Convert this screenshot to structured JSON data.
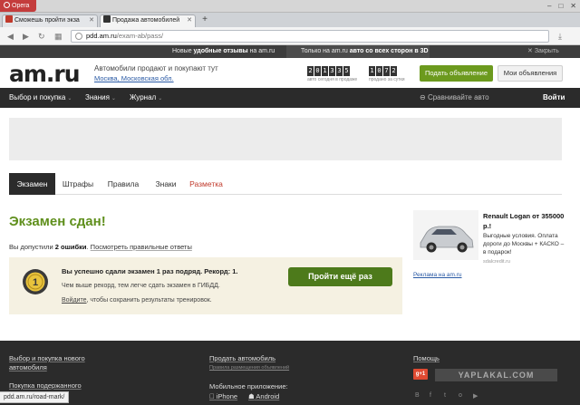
{
  "browser": {
    "menu_label": "Opera",
    "tabs": [
      {
        "title": "Сможешь пройти экза"
      },
      {
        "title": "Продажа автомобилей"
      }
    ],
    "url_host": "pdd.am.ru",
    "url_path": "/exam-ab/pass/",
    "status_url": "pdd.am.ru/road-mark/"
  },
  "promo": {
    "text1_pre": "Новые ",
    "text1_bold": "удобные отзывы",
    "text1_post": " на am.ru",
    "text2_pre": "Только на am.ru ",
    "text2_bold": "авто со всех сторон в 3D",
    "close_label": "Закрыть"
  },
  "header": {
    "logo": "am.ru",
    "tagline": "Автомобили продают и покупают тут",
    "region": "Москва, Московская обл.",
    "counter_total": "201335",
    "counter_total_label": "авто сегодня в продаже",
    "counter_day": "1072",
    "counter_day_label": "продано за сутки",
    "sell_button": "Подать объявление",
    "my_ads_button": "Мои объявления"
  },
  "menu": {
    "items": [
      "Выбор и покупка",
      "Знания",
      "Журнал"
    ],
    "compare": "Сравнивайте авто",
    "login": "Войти"
  },
  "section_tabs": [
    "Экзамен",
    "Штрафы",
    "Правила",
    "Знаки",
    "Разметка"
  ],
  "result": {
    "title": "Экзамен сдан!",
    "errors_pre": "Вы допустили ",
    "errors_count": "2 ошибки",
    "errors_post": ".",
    "show_answers": "Посмотреть правильные ответы",
    "medal_number": "1",
    "box_title": "Вы успешно сдали экзамен 1 раз подряд. Рекорд: 1.",
    "box_sub": "Чем выше рекорд, тем легче сдать экзамен в ГИБДД.",
    "login_link": "Войдите",
    "login_post": ", чтобы сохранить результаты тренировок.",
    "retry_button": "Пройти ещё раз"
  },
  "ad": {
    "title": "Renault Logan от 355000 р.!",
    "text": "Выгодные условия. Оплата дороги до Москвы + КАСКО – в подарок!",
    "source": "sdalcredit.ru",
    "footer_link": "Реклама на am.ru"
  },
  "footer": {
    "col1_link1": "Выбор и покупка нового автомобиля",
    "col1_link2": "Покупка подержанного",
    "col2_link1": "Продать автомобиль",
    "col2_small": "Правила размещения объявлений",
    "col2_label": "Мобильное приложение:",
    "col2_ios": "iPhone",
    "col2_android": "Android",
    "col3_link1": "Помощь",
    "col3_gplus": "g+1",
    "watermark": "YAPLAKAL.COM"
  },
  "colors": {
    "accent_green": "#6c9a1e",
    "title_green": "#5f8f1c",
    "dark_bar": "#2b2b2b"
  }
}
